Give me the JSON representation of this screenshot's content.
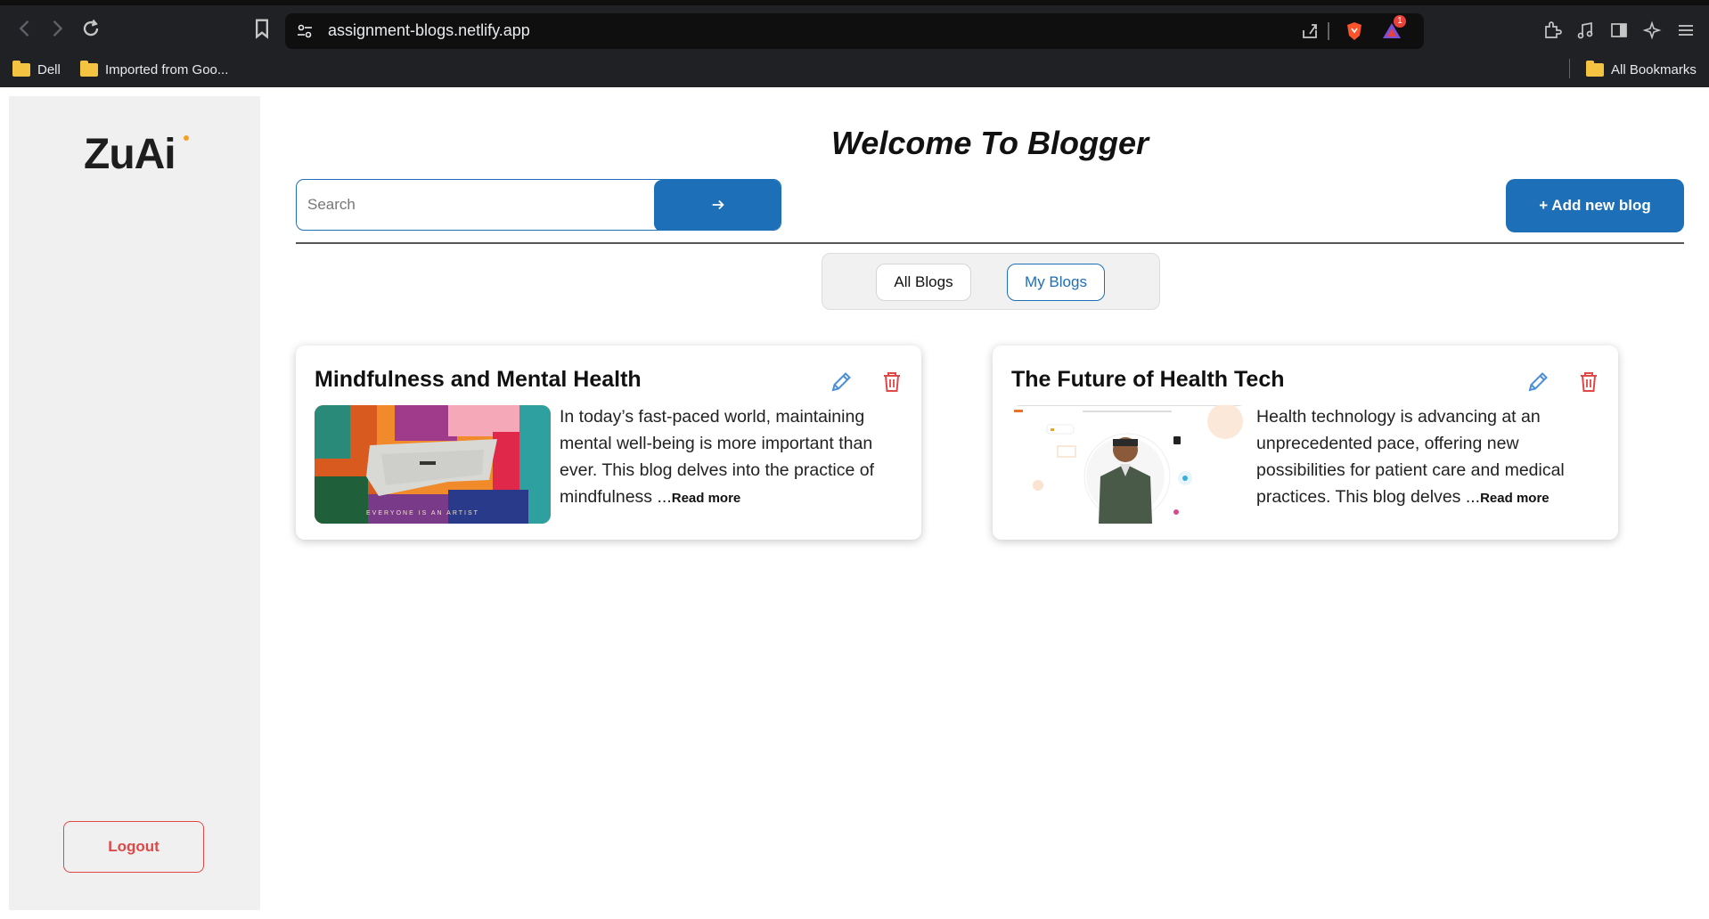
{
  "browser": {
    "url": "assignment-blogs.netlify.app",
    "shields_badge": "1",
    "bookmarks": [
      {
        "label": "Dell"
      },
      {
        "label": "Imported from Goo..."
      }
    ],
    "all_bookmarks_label": "All Bookmarks"
  },
  "sidebar": {
    "logo": "ZuAi",
    "logout_label": "Logout"
  },
  "header": {
    "title": "Welcome To Blogger",
    "search_placeholder": "Search",
    "search_value": "",
    "add_button_label": "+ Add new blog"
  },
  "tabs": {
    "all_label": "All Blogs",
    "my_label": "My Blogs",
    "active": "My Blogs"
  },
  "posts": [
    {
      "title": "Mindfulness and Mental Health",
      "excerpt": "In today’s fast-paced world, maintaining mental well-being is more important than ever. This blog delves into the practice of mindfulness",
      "ellipsis": " ...",
      "read_more": "Read more",
      "image_text": "EVERYONE IS AN ARTIST"
    },
    {
      "title": "The Future of Health Tech",
      "excerpt": "Health technology is advancing at an unprecedented pace, offering new possibilities for patient care and medical practices. This blog delves",
      "ellipsis": " ...",
      "read_more": "Read more"
    }
  ],
  "colors": {
    "primary": "#1d6fb8",
    "danger": "#e04848",
    "sidebar_bg": "#f0f0f0"
  }
}
